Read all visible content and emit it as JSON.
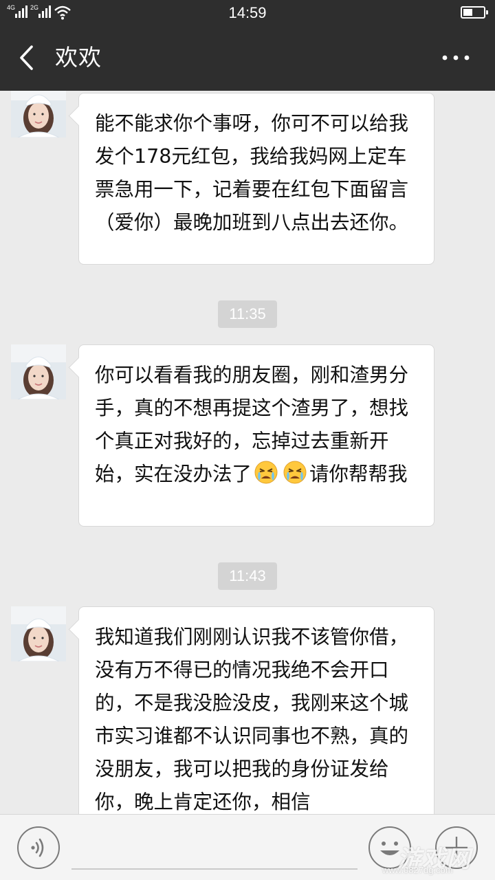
{
  "status_bar": {
    "network_1": "4G",
    "network_2": "2G",
    "time": "14:59",
    "battery_level": 0.45,
    "icons": [
      "signal-icon",
      "signal-icon",
      "wifi-icon",
      "battery-icon"
    ]
  },
  "header": {
    "title": "欢欢",
    "back_icon": "chevron-left-icon",
    "more_icon": "more-icon"
  },
  "messages": [
    {
      "type": "text",
      "sender": "contact",
      "text": "能不能求你个事呀，你可不可以给我发个178元红包，我给我妈网上定车票急用一下，记着要在红包下面留言（爱你）最晚加班到八点出去还你。"
    },
    {
      "type": "time",
      "text": "11:35"
    },
    {
      "type": "text",
      "sender": "contact",
      "text_before_emoji": "你可以看看我的朋友圈，刚和渣男分手，真的不想再提这个渣男了，想找个真正对我好的，忘掉过去重新开始，实在没办法了",
      "emoji": [
        "crying-face-icon",
        "crying-face-icon"
      ],
      "text_after_emoji": "请你帮帮我"
    },
    {
      "type": "time",
      "text": "11:43"
    },
    {
      "type": "text",
      "sender": "contact",
      "text": "我知道我们刚刚认识我不该管你借，没有万不得已的情况我绝不会开口的，不是我没脸没皮，我刚来这个城市实习谁都不认识同事也不熟，真的没朋友，我可以把我的身份证发给你，晚上肯定还你，相信"
    }
  ],
  "input_bar": {
    "voice_icon": "voice-icon",
    "input_value": "",
    "emoji_icon": "smiley-icon",
    "plus_icon": "plus-icon"
  },
  "watermark": {
    "main": "游戏网",
    "sub": "www.0827dg.com"
  },
  "colors": {
    "header_bg": "#2e2e2e",
    "chat_bg": "#ebebeb",
    "bubble_bg": "#ffffff",
    "time_pill_bg": "#d4d4d4",
    "input_bar_bg": "#f4f4f4"
  }
}
